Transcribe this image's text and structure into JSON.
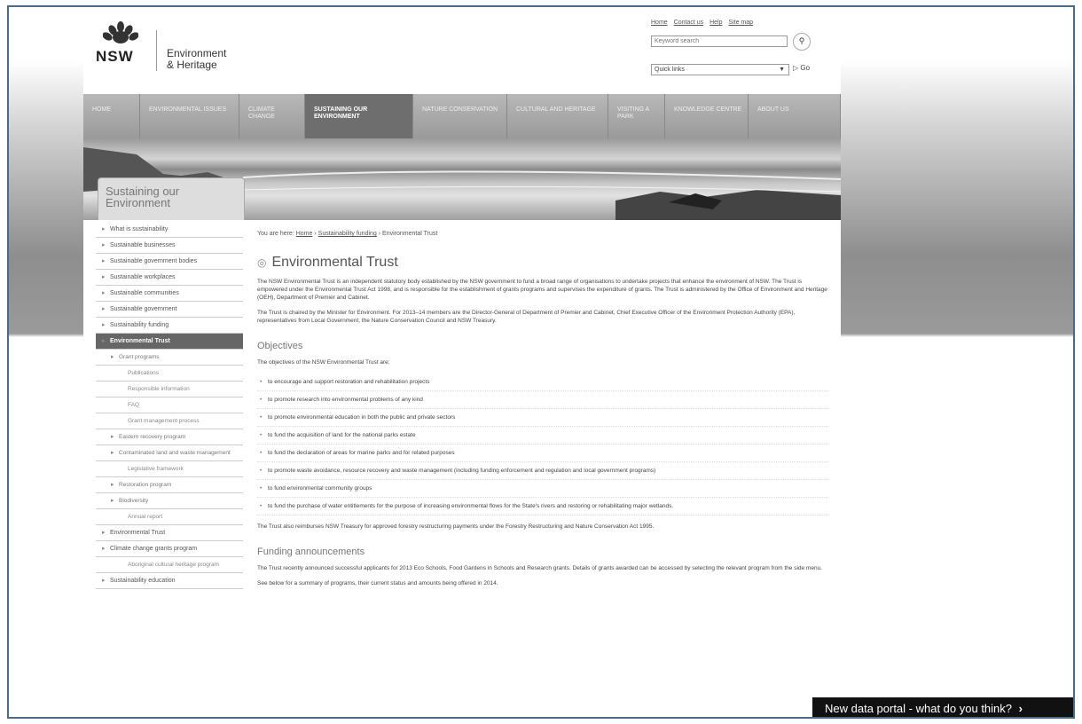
{
  "header": {
    "logo_text": "NSW",
    "brand_line1": "Environment",
    "brand_line2": "& Heritage",
    "top_links": [
      "Home",
      "Contact us",
      "Help",
      "Site map"
    ],
    "search_placeholder": "Keyword search",
    "search_icon": "search-icon",
    "select_value": "Quick links",
    "go_label": "Go"
  },
  "nav": {
    "items": [
      {
        "label": "Home"
      },
      {
        "label": "Environmental issues"
      },
      {
        "label": "Climate change"
      },
      {
        "label": "Sustaining our environment"
      },
      {
        "label": "Nature conservation"
      },
      {
        "label": "Cultural and heritage"
      },
      {
        "label": "Visiting a park"
      },
      {
        "label": "Knowledge centre"
      },
      {
        "label": "About us"
      }
    ],
    "active_index": 3
  },
  "banner": {
    "title_line1": "Sustaining our",
    "title_line2": "Environment"
  },
  "sidebar": {
    "items": [
      {
        "label": "What is sustainability",
        "level": 0
      },
      {
        "label": "Sustainable businesses",
        "level": 0
      },
      {
        "label": "Sustainable government bodies",
        "level": 0
      },
      {
        "label": "Sustainable workplaces",
        "level": 0
      },
      {
        "label": "Sustainable communities",
        "level": 0
      },
      {
        "label": "Sustainable government",
        "level": 0
      },
      {
        "label": "Sustainability funding",
        "level": 0
      },
      {
        "label": "Environmental Trust",
        "level": 0,
        "active": true
      },
      {
        "label": "Grant programs",
        "level": 1
      },
      {
        "label": "Publications",
        "level": 2
      },
      {
        "label": "Responsible information",
        "level": 2
      },
      {
        "label": "FAQ",
        "level": 2
      },
      {
        "label": "Grant management process",
        "level": 2
      },
      {
        "label": "Eastern recovery program",
        "level": 1
      },
      {
        "label": "Contaminated land and waste management",
        "level": 1
      },
      {
        "label": "Legislative framework",
        "level": 2
      },
      {
        "label": "Restoration program",
        "level": 1
      },
      {
        "label": "Biodiversity",
        "level": 1
      },
      {
        "label": "Annual report",
        "level": 2
      },
      {
        "label": "Environmental Trust",
        "level": 0
      },
      {
        "label": "Climate change grants program",
        "level": 0
      },
      {
        "label": "Aboriginal cultural heritage program",
        "level": 2
      },
      {
        "label": "Sustainability education",
        "level": 0
      }
    ]
  },
  "main": {
    "breadcrumb_prefix": "You are here:",
    "breadcrumb_home": "Home",
    "breadcrumb_funding": "Sustainability funding",
    "breadcrumb_current": "Environmental Trust",
    "title": "Environmental Trust",
    "intro1": "The NSW Environmental Trust is an independent statutory body established by the NSW government to fund a broad range of organisations to undertake projects that enhance the environment of NSW. The Trust is empowered under the Environmental Trust Act 1998, and is responsible for the establishment of grants programs and supervises the expenditure of grants. The Trust is administered by the Office of Environment and Heritage (OEH), Department of Premier and Cabinet.",
    "intro2": "The Trust is chaired by the Minister for Environment. For 2013–14 members are the Director-General of Department of Premier and Cabinet, Chief Executive Officer of the Environment Protection Authority (EPA), representatives from Local Government, the Nature Conservation Council and NSW Treasury.",
    "objectives_heading": "Objectives",
    "objectives_intro": "The objectives of the NSW Environmental Trust are:",
    "objectives": [
      "to encourage and support restoration and rehabilitation projects",
      "to promote research into environmental problems of any kind",
      "to promote environmental education in both the public and private sectors",
      "to fund the acquisition of land for the national parks estate",
      "to fund the declaration of areas for marine parks and for related purposes",
      "to promote waste avoidance, resource recovery and waste management (including funding enforcement and regulation and local government programs)",
      "to fund environmental community groups",
      "to fund the purchase of water entitlements for the purpose of increasing environmental flows for the State's rivers and restoring or rehabilitating major wetlands."
    ],
    "trust_reimburses": "The Trust also reimburses NSW Treasury for approved forestry restructuring payments under the Forestry Restructuring and Nature Conservation Act 1995.",
    "funding_heading": "Funding announcements",
    "funding_text": "The Trust recently announced successful applicants for 2013 Eco Schools, Food Gardens in Schools and Research grants. Details of grants awarded can be accessed by selecting the relevant program from the side menu.",
    "funding_below": "See below for a summary of programs, their current status and amounts being offered in 2014."
  },
  "feedback": {
    "label": "New data portal - what do you think?",
    "arrow": "›"
  }
}
